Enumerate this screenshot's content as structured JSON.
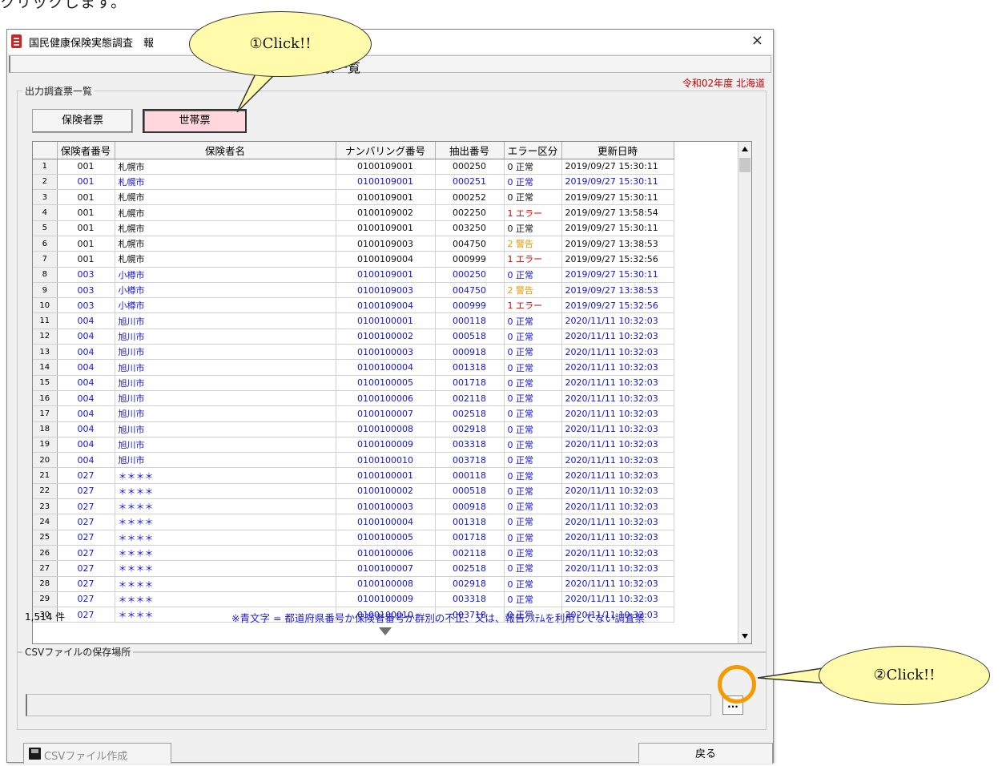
{
  "page_fragment": "クリックします。",
  "window": {
    "title": "国民健康保険実態調査　報",
    "header_title": "出力調査票一覧",
    "close_glyph": "×",
    "fiscal_label": "令和02年度  北海道"
  },
  "output_group": {
    "label": "出力調査票一覧",
    "insurer_button": "保険者票",
    "household_button": "世帯票"
  },
  "table": {
    "headers": [
      "",
      "保険者番号",
      "保険者名",
      "ナンバリング番号",
      "抽出番号",
      "エラー区分",
      "更新日時"
    ],
    "rows": [
      {
        "n": "1",
        "insurer_no": "001",
        "insurer_name": "札幌市",
        "numbering": "0100109001",
        "extract": "000250",
        "error": "0 正常",
        "updated": "2019/09/27 15:30:11"
      },
      {
        "n": "2",
        "insurer_no": "001",
        "insurer_name": "札幌市",
        "numbering": "0100109001",
        "extract": "000251",
        "error": "0 正常",
        "updated": "2019/09/27 15:30:11"
      },
      {
        "n": "3",
        "insurer_no": "001",
        "insurer_name": "札幌市",
        "numbering": "0100109001",
        "extract": "000252",
        "error": "0 正常",
        "updated": "2019/09/27 15:30:11"
      },
      {
        "n": "4",
        "insurer_no": "001",
        "insurer_name": "札幌市",
        "numbering": "0100109002",
        "extract": "002250",
        "error": "1 エラー",
        "updated": "2019/09/27 13:58:54"
      },
      {
        "n": "5",
        "insurer_no": "001",
        "insurer_name": "札幌市",
        "numbering": "0100109001",
        "extract": "003250",
        "error": "0 正常",
        "updated": "2019/09/27 15:30:11"
      },
      {
        "n": "6",
        "insurer_no": "001",
        "insurer_name": "札幌市",
        "numbering": "0100109003",
        "extract": "004750",
        "error": "2 警告",
        "updated": "2019/09/27 13:38:53"
      },
      {
        "n": "7",
        "insurer_no": "001",
        "insurer_name": "札幌市",
        "numbering": "0100109004",
        "extract": "000999",
        "error": "1 エラー",
        "updated": "2019/09/27 15:32:56"
      },
      {
        "n": "8",
        "insurer_no": "003",
        "insurer_name": "小樽市",
        "numbering": "0100109001",
        "extract": "000250",
        "error": "0 正常",
        "updated": "2019/09/27 15:30:11"
      },
      {
        "n": "9",
        "insurer_no": "003",
        "insurer_name": "小樽市",
        "numbering": "0100109003",
        "extract": "004750",
        "error": "2 警告",
        "updated": "2019/09/27 13:38:53"
      },
      {
        "n": "10",
        "insurer_no": "003",
        "insurer_name": "小樽市",
        "numbering": "0100109004",
        "extract": "000999",
        "error": "1 エラー",
        "updated": "2019/09/27 15:32:56"
      },
      {
        "n": "11",
        "insurer_no": "004",
        "insurer_name": "旭川市",
        "numbering": "0100100001",
        "extract": "000118",
        "error": "0 正常",
        "updated": "2020/11/11 10:32:03"
      },
      {
        "n": "12",
        "insurer_no": "004",
        "insurer_name": "旭川市",
        "numbering": "0100100002",
        "extract": "000518",
        "error": "0 正常",
        "updated": "2020/11/11 10:32:03"
      },
      {
        "n": "13",
        "insurer_no": "004",
        "insurer_name": "旭川市",
        "numbering": "0100100003",
        "extract": "000918",
        "error": "0 正常",
        "updated": "2020/11/11 10:32:03"
      },
      {
        "n": "14",
        "insurer_no": "004",
        "insurer_name": "旭川市",
        "numbering": "0100100004",
        "extract": "001318",
        "error": "0 正常",
        "updated": "2020/11/11 10:32:03"
      },
      {
        "n": "15",
        "insurer_no": "004",
        "insurer_name": "旭川市",
        "numbering": "0100100005",
        "extract": "001718",
        "error": "0 正常",
        "updated": "2020/11/11 10:32:03"
      },
      {
        "n": "16",
        "insurer_no": "004",
        "insurer_name": "旭川市",
        "numbering": "0100100006",
        "extract": "002118",
        "error": "0 正常",
        "updated": "2020/11/11 10:32:03"
      },
      {
        "n": "17",
        "insurer_no": "004",
        "insurer_name": "旭川市",
        "numbering": "0100100007",
        "extract": "002518",
        "error": "0 正常",
        "updated": "2020/11/11 10:32:03"
      },
      {
        "n": "18",
        "insurer_no": "004",
        "insurer_name": "旭川市",
        "numbering": "0100100008",
        "extract": "002918",
        "error": "0 正常",
        "updated": "2020/11/11 10:32:03"
      },
      {
        "n": "19",
        "insurer_no": "004",
        "insurer_name": "旭川市",
        "numbering": "0100100009",
        "extract": "003318",
        "error": "0 正常",
        "updated": "2020/11/11 10:32:03"
      },
      {
        "n": "20",
        "insurer_no": "004",
        "insurer_name": "旭川市",
        "numbering": "0100100010",
        "extract": "003718",
        "error": "0 正常",
        "updated": "2020/11/11 10:32:03"
      },
      {
        "n": "21",
        "insurer_no": "027",
        "insurer_name": "＊＊＊＊",
        "numbering": "0100100001",
        "extract": "000118",
        "error": "0 正常",
        "updated": "2020/11/11 10:32:03"
      },
      {
        "n": "22",
        "insurer_no": "027",
        "insurer_name": "＊＊＊＊",
        "numbering": "0100100002",
        "extract": "000518",
        "error": "0 正常",
        "updated": "2020/11/11 10:32:03"
      },
      {
        "n": "23",
        "insurer_no": "027",
        "insurer_name": "＊＊＊＊",
        "numbering": "0100100003",
        "extract": "000918",
        "error": "0 正常",
        "updated": "2020/11/11 10:32:03"
      },
      {
        "n": "24",
        "insurer_no": "027",
        "insurer_name": "＊＊＊＊",
        "numbering": "0100100004",
        "extract": "001318",
        "error": "0 正常",
        "updated": "2020/11/11 10:32:03"
      },
      {
        "n": "25",
        "insurer_no": "027",
        "insurer_name": "＊＊＊＊",
        "numbering": "0100100005",
        "extract": "001718",
        "error": "0 正常",
        "updated": "2020/11/11 10:32:03"
      },
      {
        "n": "26",
        "insurer_no": "027",
        "insurer_name": "＊＊＊＊",
        "numbering": "0100100006",
        "extract": "002118",
        "error": "0 正常",
        "updated": "2020/11/11 10:32:03"
      },
      {
        "n": "27",
        "insurer_no": "027",
        "insurer_name": "＊＊＊＊",
        "numbering": "0100100007",
        "extract": "002518",
        "error": "0 正常",
        "updated": "2020/11/11 10:32:03"
      },
      {
        "n": "28",
        "insurer_no": "027",
        "insurer_name": "＊＊＊＊",
        "numbering": "0100100008",
        "extract": "002918",
        "error": "0 正常",
        "updated": "2020/11/11 10:32:03"
      },
      {
        "n": "29",
        "insurer_no": "027",
        "insurer_name": "＊＊＊＊",
        "numbering": "0100100009",
        "extract": "003318",
        "error": "0 正常",
        "updated": "2020/11/11 10:32:03"
      },
      {
        "n": "30",
        "insurer_no": "027",
        "insurer_name": "＊＊＊＊",
        "numbering": "0100100010",
        "extract": "003718",
        "error": "0 正常",
        "updated": "2020/11/11 10:32:03"
      }
    ],
    "row_text_colors": [
      "black",
      "blue",
      "black",
      "black",
      "black",
      "black",
      "black",
      "blue",
      "blue",
      "blue",
      "blue",
      "blue",
      "blue",
      "blue",
      "blue",
      "blue",
      "blue",
      "blue",
      "blue",
      "blue",
      "blue",
      "blue",
      "blue",
      "blue",
      "blue",
      "blue",
      "blue",
      "blue",
      "blue",
      "blue"
    ]
  },
  "footer": {
    "count": "1,514 件",
    "note": "※青文字 = 都道府県番号か保険者番号か群別の不正、又は、報告ｼｽﾃﾑを利用してない調査票"
  },
  "csv_group": {
    "label": "CSVファイルの保存場所",
    "path_value": "",
    "browse_label": "..."
  },
  "buttons": {
    "csv_create": "CSVファイル作成",
    "back": "戻る"
  },
  "callouts": {
    "first": "①Click!!",
    "second": "②Click!!"
  },
  "colors": {
    "blue_text": "#1515d0",
    "error_red": "#e00000",
    "warning_orange": "#e89a00",
    "fiscal_red": "#c00000",
    "callout_fill": "#fffbaa",
    "highlight_ring": "#f59b00",
    "household_button_fill": "#ffd8de"
  }
}
